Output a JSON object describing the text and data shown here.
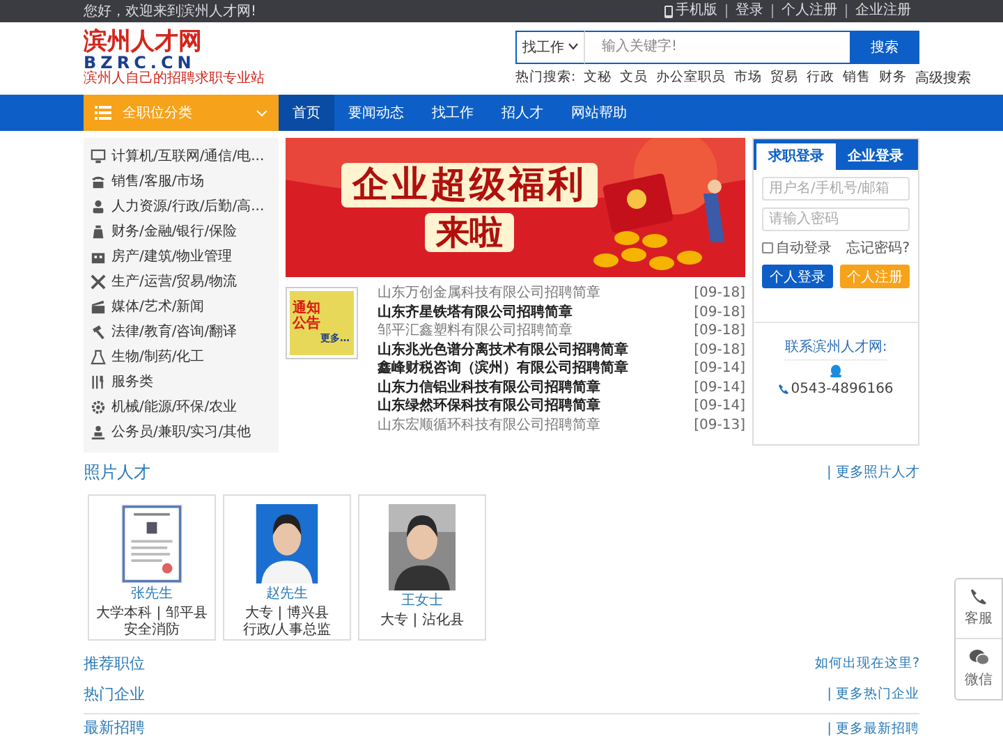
{
  "top_bar": {
    "welcome": "您好，欢迎来到滨州人才网!",
    "links": [
      "手机版",
      "登录",
      "个人注册",
      "企业注册"
    ]
  },
  "header": {
    "logo": {
      "name": "滨州人才网",
      "domain": "BZRC.CN",
      "tagline": "滨州人自己的招聘求职专业站"
    },
    "search": {
      "type": "找工作",
      "placeholder": "输入关键字!",
      "button": "搜索"
    },
    "hot_label": "热门搜索:",
    "hot_terms": [
      "文秘",
      "文员",
      "办公室职员",
      "市场",
      "贸易",
      "行政",
      "销售",
      "财务"
    ],
    "advanced": "高级搜索"
  },
  "nav": {
    "category_button": "全职位分类",
    "items": [
      {
        "label": "首页",
        "selected": true
      },
      {
        "label": "要闻动态",
        "selected": false
      },
      {
        "label": "找工作",
        "selected": false
      },
      {
        "label": "招人才",
        "selected": false
      },
      {
        "label": "网站帮助",
        "selected": false
      }
    ]
  },
  "categories": [
    "计算机/互联网/通信/电...",
    "销售/客服/市场",
    "人力资源/行政/后勤/高...",
    "财务/金融/银行/保险",
    "房产/建筑/物业管理",
    "生产/运营/贸易/物流",
    "媒体/艺术/新闻",
    "法律/教育/咨询/翻译",
    "生物/制药/化工",
    "服务类",
    "机械/能源/环保/农业",
    "公务员/兼职/实习/其他"
  ],
  "banner": {
    "headline": "企业超级福利",
    "subline": "来啦"
  },
  "notice": {
    "title_1": "通知",
    "title_2": "公告",
    "more": "更多…"
  },
  "news": [
    {
      "title": "山东万创金属科技有限公司招聘简章",
      "date": "[09-18]",
      "bold": false
    },
    {
      "title": "山东齐星铁塔有限公司招聘简章",
      "date": "[09-18]",
      "bold": true
    },
    {
      "title": "邹平汇鑫塑料有限公司招聘简章",
      "date": "[09-18]",
      "bold": false
    },
    {
      "title": "山东兆光色谱分离技术有限公司招聘简章",
      "date": "[09-18]",
      "bold": true
    },
    {
      "title": "鑫峰财税咨询（滨州）有限公司招聘简章",
      "date": "[09-14]",
      "bold": true
    },
    {
      "title": "山东力信铝业科技有限公司招聘简章",
      "date": "[09-14]",
      "bold": true
    },
    {
      "title": "山东绿然环保科技有限公司招聘简章",
      "date": "[09-14]",
      "bold": true
    },
    {
      "title": "山东宏顺循环科技有限公司招聘简章",
      "date": "[09-13]",
      "bold": false
    }
  ],
  "login": {
    "tabs": [
      {
        "label": "求职登录",
        "selected": true
      },
      {
        "label": "企业登录",
        "selected": false
      }
    ],
    "username_placeholder": "用户名/手机号/邮箱",
    "password_placeholder": "请输入密码",
    "auto_login": {
      "label": "自动登录",
      "checked": false
    },
    "forgot": "忘记密码?",
    "login_button": "个人登录",
    "register_button": "个人注册",
    "contact_title": "联系滨州人才网:",
    "phone": "0543-4896166"
  },
  "photo_talent": {
    "title": "照片人才",
    "more": "| 更多照片人才",
    "people": [
      {
        "name": "张先生",
        "lines": [
          "大学本科 | 邹平县",
          "安全消防"
        ],
        "kind": "certificate"
      },
      {
        "name": "赵先生",
        "lines": [
          "大专 | 博兴县",
          "行政/人事总监"
        ],
        "kind": "man"
      },
      {
        "name": "王女士",
        "lines": [
          "大专 | 沾化县"
        ],
        "kind": "woman"
      }
    ]
  },
  "sections": [
    {
      "title": "推荐职位",
      "link": "如何出现在这里?",
      "divider": false
    },
    {
      "title": "热门企业",
      "link": "| 更多热门企业",
      "divider": false
    },
    {
      "title": "最新招聘",
      "link": "| 更多最新招聘",
      "divider": true
    }
  ],
  "float_bar": [
    "客服",
    "微信"
  ]
}
